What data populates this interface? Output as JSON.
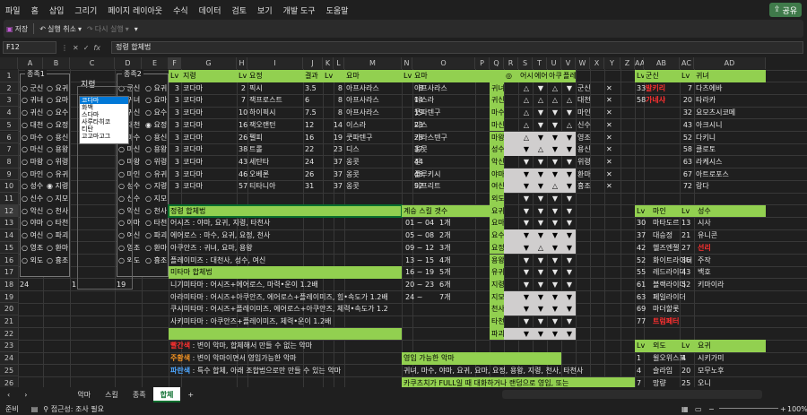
{
  "menu": [
    "파일",
    "홈",
    "삽입",
    "그리기",
    "페이지 레이아웃",
    "수식",
    "데이터",
    "검토",
    "보기",
    "개발 도구",
    "도움말"
  ],
  "share_label": "공유",
  "qat": {
    "save": "저장",
    "undo": "실행 취소",
    "redo": "다시 실행"
  },
  "namebox": "F12",
  "formula": "정령 합체법",
  "columns": [
    "A",
    "B",
    "C",
    "D",
    "E",
    "F",
    "G",
    "H",
    "I",
    "J",
    "K",
    "L",
    "M",
    "N",
    "O",
    "P",
    "Q",
    "R",
    "S",
    "T",
    "U",
    "V",
    "W",
    "X",
    "Y",
    "Z",
    "AA",
    "AB",
    "AC",
    "AD"
  ],
  "rows": [
    "1",
    "2",
    "3",
    "4",
    "5",
    "6",
    "7",
    "8",
    "9",
    "10",
    "11",
    "12",
    "13",
    "14",
    "15",
    "16",
    "17",
    "18",
    "19",
    "20",
    "21",
    "22",
    "23",
    "24",
    "25",
    "26"
  ],
  "group1": {
    "title": "종족1",
    "left": [
      "군신",
      "귀녀",
      "귀신",
      "대천",
      "마수",
      "마신",
      "마왕",
      "마인",
      "성수",
      "신수",
      "악신",
      "야마",
      "여신",
      "영조",
      "외도"
    ],
    "right": [
      "요귀",
      "요마",
      "요수",
      "요정",
      "용신",
      "용왕",
      "위령",
      "유귀",
      "지령",
      "지모",
      "천사",
      "타천",
      "파괴",
      "환마",
      "흉조"
    ],
    "selected_right": "지령"
  },
  "group2": {
    "title": "종족2",
    "left": [
      "군신",
      "귀녀",
      "귀신",
      "대천",
      "마수",
      "마신",
      "마왕",
      "마인",
      "성수",
      "신수",
      "악신",
      "야마",
      "여신",
      "영조",
      "외도"
    ],
    "right": [
      "요귀",
      "요마",
      "요수",
      "요정",
      "용신",
      "용왕",
      "위령",
      "유귀",
      "지령",
      "지모",
      "천사",
      "타천",
      "파괴",
      "환마",
      "흉조"
    ],
    "selected_right": "요정"
  },
  "list_title": "지령",
  "list_items": [
    "코다마",
    "화백",
    "스다마",
    "사루타히코",
    "티탄",
    "고고마고그"
  ],
  "row18": {
    "a": "24",
    "c": "1",
    "d": "19"
  },
  "table1": {
    "h": [
      "Lv",
      "지령",
      "Lv",
      "요정",
      "결과",
      "Lv",
      "요마"
    ],
    "rows": [
      [
        "3",
        "코다마",
        "2",
        "픽시",
        "3.5",
        "8",
        "아프사라스"
      ],
      [
        "3",
        "코다마",
        "7",
        "잭프로스트",
        "6",
        "8",
        "아프사라스"
      ],
      [
        "3",
        "코다마",
        "10",
        "하이픽시",
        "7.5",
        "8",
        "아프사라스"
      ],
      [
        "3",
        "코다마",
        "16",
        "잭오랜턴",
        "12",
        "14",
        "이스라"
      ],
      [
        "3",
        "코다마",
        "26",
        "펠피",
        "16",
        "19",
        "쿳파텐구"
      ],
      [
        "3",
        "코다마",
        "38",
        "트롤",
        "22",
        "23",
        "디스"
      ],
      [
        "3",
        "코다마",
        "43",
        "세탄타",
        "24",
        "37",
        "옹콧"
      ],
      [
        "3",
        "코다마",
        "46",
        "오베론",
        "26",
        "37",
        "옹콧"
      ],
      [
        "3",
        "코다마",
        "57",
        "티타니아",
        "31",
        "37",
        "옹콧"
      ]
    ]
  },
  "table2": {
    "h": [
      "Lv",
      "요마"
    ],
    "rows": [
      [
        "8",
        "아프사라스"
      ],
      [
        "14",
        "이스라"
      ],
      [
        "19",
        "쿳파텐구"
      ],
      [
        "23",
        "디스"
      ],
      [
        "28",
        "카라스텐구"
      ],
      [
        "37",
        "옹콧"
      ],
      [
        "44",
        "진"
      ],
      [
        "48",
        "플루키시"
      ],
      [
        "52",
        "이프리트"
      ]
    ]
  },
  "races": [
    "귀녀",
    "귀신",
    "마수",
    "마신",
    "마왕",
    "성수",
    "악신",
    "야마",
    "여신",
    "외도",
    "요귀",
    "요마",
    "요수",
    "요정",
    "용왕",
    "유귀",
    "지령",
    "지모",
    "천사",
    "타천",
    "파괴"
  ],
  "race_header": [
    "◎",
    "어시",
    "에어",
    "아쿠",
    "플레"
  ],
  "race_marks": [
    [
      "△",
      "▼",
      "△",
      "▼"
    ],
    [
      "△",
      "△",
      "△",
      "△"
    ],
    [
      "△",
      "▼",
      "▼",
      "▼"
    ],
    [
      "△",
      "▼",
      "▼",
      "△"
    ],
    [
      "△",
      "▼",
      "▼",
      "▼"
    ],
    [
      "▼",
      "△",
      "▼",
      "▼"
    ],
    [
      "▼",
      "▼",
      "▼",
      "▼"
    ],
    [
      "▼",
      "▼",
      "▼",
      "▼"
    ],
    [
      "▼",
      "▼",
      "△",
      "▼"
    ],
    [
      "▼",
      "▼",
      "▼",
      "▼"
    ],
    [
      "▼",
      "▼",
      "▼",
      "▼"
    ],
    [
      "▼",
      "▼",
      "▼",
      "▼"
    ],
    [
      "▼",
      "▼",
      "▼",
      "▼"
    ],
    [
      "▼",
      "△",
      "▼",
      "▼"
    ],
    [
      "▼",
      "▼",
      "▼",
      "▼"
    ],
    [
      "▼",
      "▼",
      "▼",
      "▼"
    ],
    [
      "▼",
      "▼",
      "▼",
      "▼"
    ],
    [
      "▼",
      "▼",
      "▼",
      "▼"
    ],
    [
      "▼",
      "▼",
      "▼",
      "▼"
    ],
    [
      "▼",
      "▼",
      "▼",
      "▼"
    ],
    [
      "▼",
      "▼",
      "▼",
      "▼"
    ]
  ],
  "x_col": [
    [
      "군신",
      "✕"
    ],
    [
      "대천",
      "✕"
    ],
    [
      "마인",
      "✕"
    ],
    [
      "신수",
      "✕"
    ],
    [
      "영조",
      "✕"
    ],
    [
      "용신",
      "✕"
    ],
    [
      "위령",
      "✕"
    ],
    [
      "환마",
      "✕"
    ],
    [
      "흉조",
      "✕"
    ]
  ],
  "gunsin": {
    "h": [
      "Lv",
      "군신"
    ],
    "rows": [
      [
        "33",
        "발키리"
      ],
      [
        "58",
        "가네샤"
      ]
    ]
  },
  "gwinyeo": {
    "h": [
      "Lv",
      "귀녀"
    ],
    "rows": [
      [
        "7",
        "다츠에바"
      ],
      [
        "20",
        "타라카"
      ],
      [
        "32",
        "요모츠시코메"
      ],
      [
        "43",
        "아크시니"
      ],
      [
        "52",
        "다키니"
      ],
      [
        "58",
        "클로토"
      ],
      [
        "63",
        "라케시스"
      ],
      [
        "67",
        "아트로포스"
      ],
      [
        "72",
        "랑다"
      ]
    ]
  },
  "spirit": {
    "title": "정령 합체법",
    "lines": [
      "어시즈 : 야마, 요귀, 지령, 타천사",
      "에어로스 : 마수, 요귀, 요정, 천사",
      "아쿠안즈 : 귀녀, 요마, 용왕",
      "플레이미즈 : 대천사, 성수, 여신"
    ]
  },
  "mitama": {
    "title": "미타마 합체법",
    "lines": [
      "니기미타마 : 어시즈+에어로스, 마력•운이 1.2배",
      "아라미타마 : 어시즈+아쿠안즈, 에어로스+플레이미즈, 힘•속도가 1.2배",
      "쿠시미타마 : 어시즈+플레이미즈, 에어로스+아쿠안즈, 체력•속도가 1.2",
      "사키미타마 : 아쿠안즈+플레이미즈, 체력•운이 1.2배"
    ]
  },
  "legend": [
    {
      "k": "빨간색",
      "t": " : 변이 악마, 합체해서 만들 수 없는 악마"
    },
    {
      "k": "주황색",
      "t": " : 변이 악마이면서 영입가능한 악마"
    },
    {
      "k": "파란색",
      "t": " : 특수 합체, 아래 조합법으로만 만들 수 있는 악마"
    }
  ],
  "skills": {
    "title": "계승 스킬 갯수",
    "rows": [
      [
        "01 ~ 04",
        "1개"
      ],
      [
        "05 ~ 08",
        "2개"
      ],
      [
        "09 ~ 12",
        "3개"
      ],
      [
        "13 ~ 15",
        "4개"
      ],
      [
        "16 ~ 19",
        "5개"
      ],
      [
        "20 ~ 23",
        "6개"
      ],
      [
        "24 ~",
        "7개"
      ]
    ]
  },
  "recruit": {
    "title": "영입 가능한 악마",
    "line": "귀녀, 마수, 야마, 요귀, 요마, 요정, 용왕, 지령, 천사, 타천사",
    "line2": "카쿠츠치가 FULL일 때 대화하거나 랜덤으로 영입, 또는"
  },
  "main": {
    "h": [
      "Lv",
      "마인"
    ],
    "rows": [
      [
        "30",
        "마타도르"
      ],
      [
        "37",
        "대승정"
      ],
      [
        "42",
        "헬즈엔젤"
      ],
      [
        "52",
        "화이트라이더"
      ],
      [
        "55",
        "레드라이더"
      ],
      [
        "61",
        "블랙라이더"
      ],
      [
        "63",
        "페일라이더"
      ],
      [
        "69",
        "마더할롯"
      ],
      [
        "77",
        "트럼페터"
      ]
    ]
  },
  "seongsu": {
    "h": [
      "Lv",
      "성수"
    ],
    "rows": [
      [
        "13",
        "시사"
      ],
      [
        "21",
        "유니콘"
      ],
      [
        "27",
        "선리"
      ],
      [
        "36",
        "주작"
      ],
      [
        "43",
        "백호"
      ],
      [
        "52",
        "키마이라"
      ]
    ]
  },
  "oedo": {
    "h": [
      "Lv",
      "외도"
    ],
    "rows": [
      [
        "1",
        "윌오위스프"
      ],
      [
        "4",
        "슬라임"
      ],
      [
        "7",
        "망량"
      ]
    ]
  },
  "yogwi": {
    "h": [
      "Lv",
      "요귀"
    ],
    "rows": [
      [
        "4",
        "시키가미"
      ],
      [
        "20",
        "모무노후"
      ],
      [
        "25",
        "오니"
      ]
    ]
  },
  "sheets": [
    "악마",
    "스킬",
    "종족",
    "합체"
  ],
  "status": {
    "ready": "준비",
    "access": "접근성: 조사 필요",
    "zoom": "100%"
  }
}
